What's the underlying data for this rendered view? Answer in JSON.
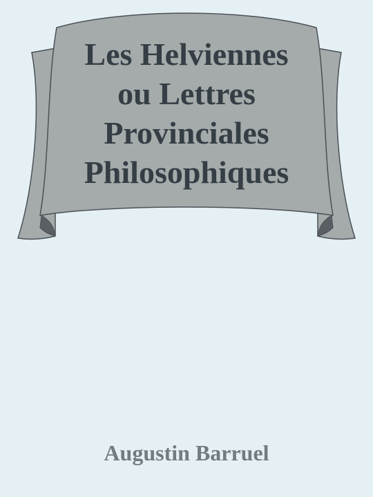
{
  "cover": {
    "title_lines": [
      "Les Helviennes",
      "ou Lettres",
      "Provinciales",
      "Philosophiques"
    ],
    "author": "Augustin Barruel"
  },
  "colors": {
    "background": "#e5f0f5",
    "banner_fill": "#a5aaaa",
    "banner_fold_fill": "#5b5f63",
    "banner_outline": "#4a5157",
    "title_text": "#353e45",
    "author_text": "#707b82"
  }
}
